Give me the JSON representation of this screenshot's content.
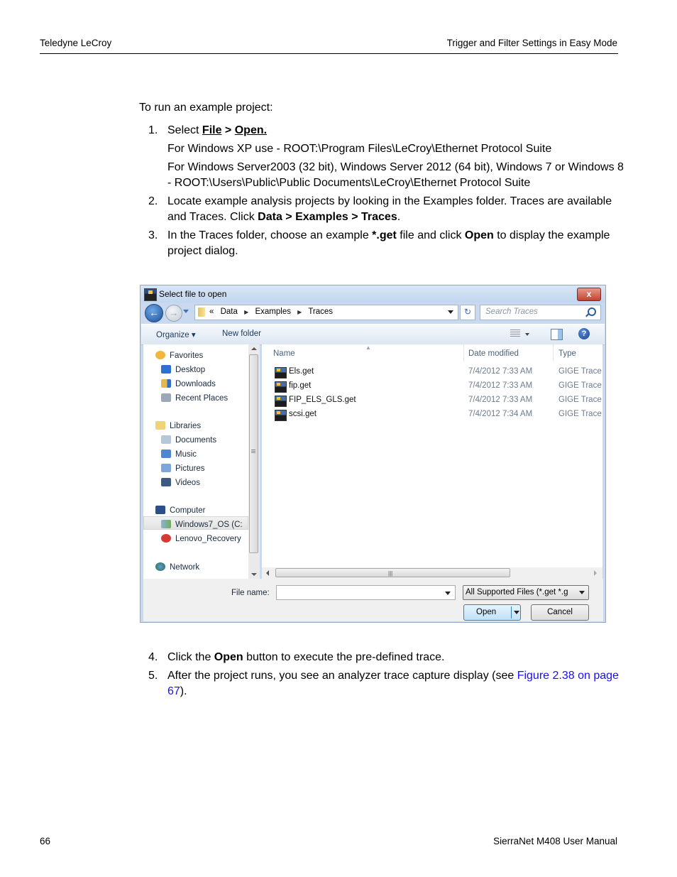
{
  "header": {
    "left": "Teledyne LeCroy",
    "right": "Trigger and Filter Settings in Easy Mode"
  },
  "footer": {
    "page_number": "66",
    "right": "SierraNet M408 User Manual"
  },
  "intro": "To run an example project:",
  "steps": [
    {
      "num": "1.",
      "pre": "Select ",
      "bold1": "File",
      "mid": " > ",
      "bold2": "Open.",
      "sub1": "For Windows XP use - ROOT:\\Program Files\\LeCroy\\Ethernet Protocol Suite",
      "sub2": "For Windows Server2003 (32 bit), Windows Server 2012 (64 bit), Windows 7 or Windows 8 - ROOT:\\Users\\Public\\Public Documents\\LeCroy\\Ethernet Protocol Suite"
    },
    {
      "num": "2.",
      "pre": "Locate example analysis projects by looking in the Examples folder. Traces are available and Traces. Click ",
      "bold": "Data > Examples > Traces",
      "post": "."
    },
    {
      "num": "3.",
      "pre": "In the Traces folder, choose an example ",
      "bold1": "*.get",
      "mid": " file and click ",
      "bold2": "Open",
      "post": " to display the example project dialog."
    },
    {
      "num": "4.",
      "pre": "Click the ",
      "bold": "Open",
      "post": " button to execute the pre-defined trace."
    },
    {
      "num": "5.",
      "pre": "After the project runs, you see an analyzer trace capture display (see ",
      "link": "Figure 2.38 on page 67",
      "post": ")."
    }
  ],
  "dialog": {
    "title": "Select file to open",
    "close_label": "x",
    "breadcrumb": {
      "overflow": "«",
      "items": [
        "Data",
        "Examples",
        "Traces"
      ]
    },
    "search_placeholder": "Search Traces",
    "toolbar": {
      "organize": "Organize ▾",
      "new_folder": "New folder"
    },
    "nav_pane": [
      {
        "label": "Favorites",
        "icon": "star-icon",
        "indent": 0
      },
      {
        "label": "Desktop",
        "icon": "desktop-icon",
        "indent": 1
      },
      {
        "label": "Downloads",
        "icon": "downloads-icon",
        "indent": 1
      },
      {
        "label": "Recent Places",
        "icon": "recent-places-icon",
        "indent": 1
      },
      {
        "label": "Libraries",
        "icon": "libraries-icon",
        "indent": 0
      },
      {
        "label": "Documents",
        "icon": "documents-icon",
        "indent": 1
      },
      {
        "label": "Music",
        "icon": "music-icon",
        "indent": 1
      },
      {
        "label": "Pictures",
        "icon": "pictures-icon",
        "indent": 1
      },
      {
        "label": "Videos",
        "icon": "videos-icon",
        "indent": 1
      },
      {
        "label": "Computer",
        "icon": "computer-icon",
        "indent": 0
      },
      {
        "label": "Windows7_OS (C:",
        "icon": "drive-icon",
        "indent": 1,
        "selected": true
      },
      {
        "label": "Lenovo_Recovery",
        "icon": "recovery-drive-icon",
        "indent": 1
      },
      {
        "label": "Network",
        "icon": "network-icon",
        "indent": 0
      }
    ],
    "columns": {
      "name": "Name",
      "date": "Date modified",
      "type": "Type"
    },
    "files": [
      {
        "name": "Els.get",
        "date": "7/4/2012 7:33 AM",
        "type": "GIGE Trace"
      },
      {
        "name": "fip.get",
        "date": "7/4/2012 7:33 AM",
        "type": "GIGE Trace"
      },
      {
        "name": "FIP_ELS_GLS.get",
        "date": "7/4/2012 7:33 AM",
        "type": "GIGE Trace"
      },
      {
        "name": "scsi.get",
        "date": "7/4/2012 7:34 AM",
        "type": "GIGE Trace"
      }
    ],
    "file_name_label": "File name:",
    "file_name_value": "",
    "filter": "All Supported Files (*.get *.g",
    "open_label": "Open",
    "cancel_label": "Cancel"
  }
}
